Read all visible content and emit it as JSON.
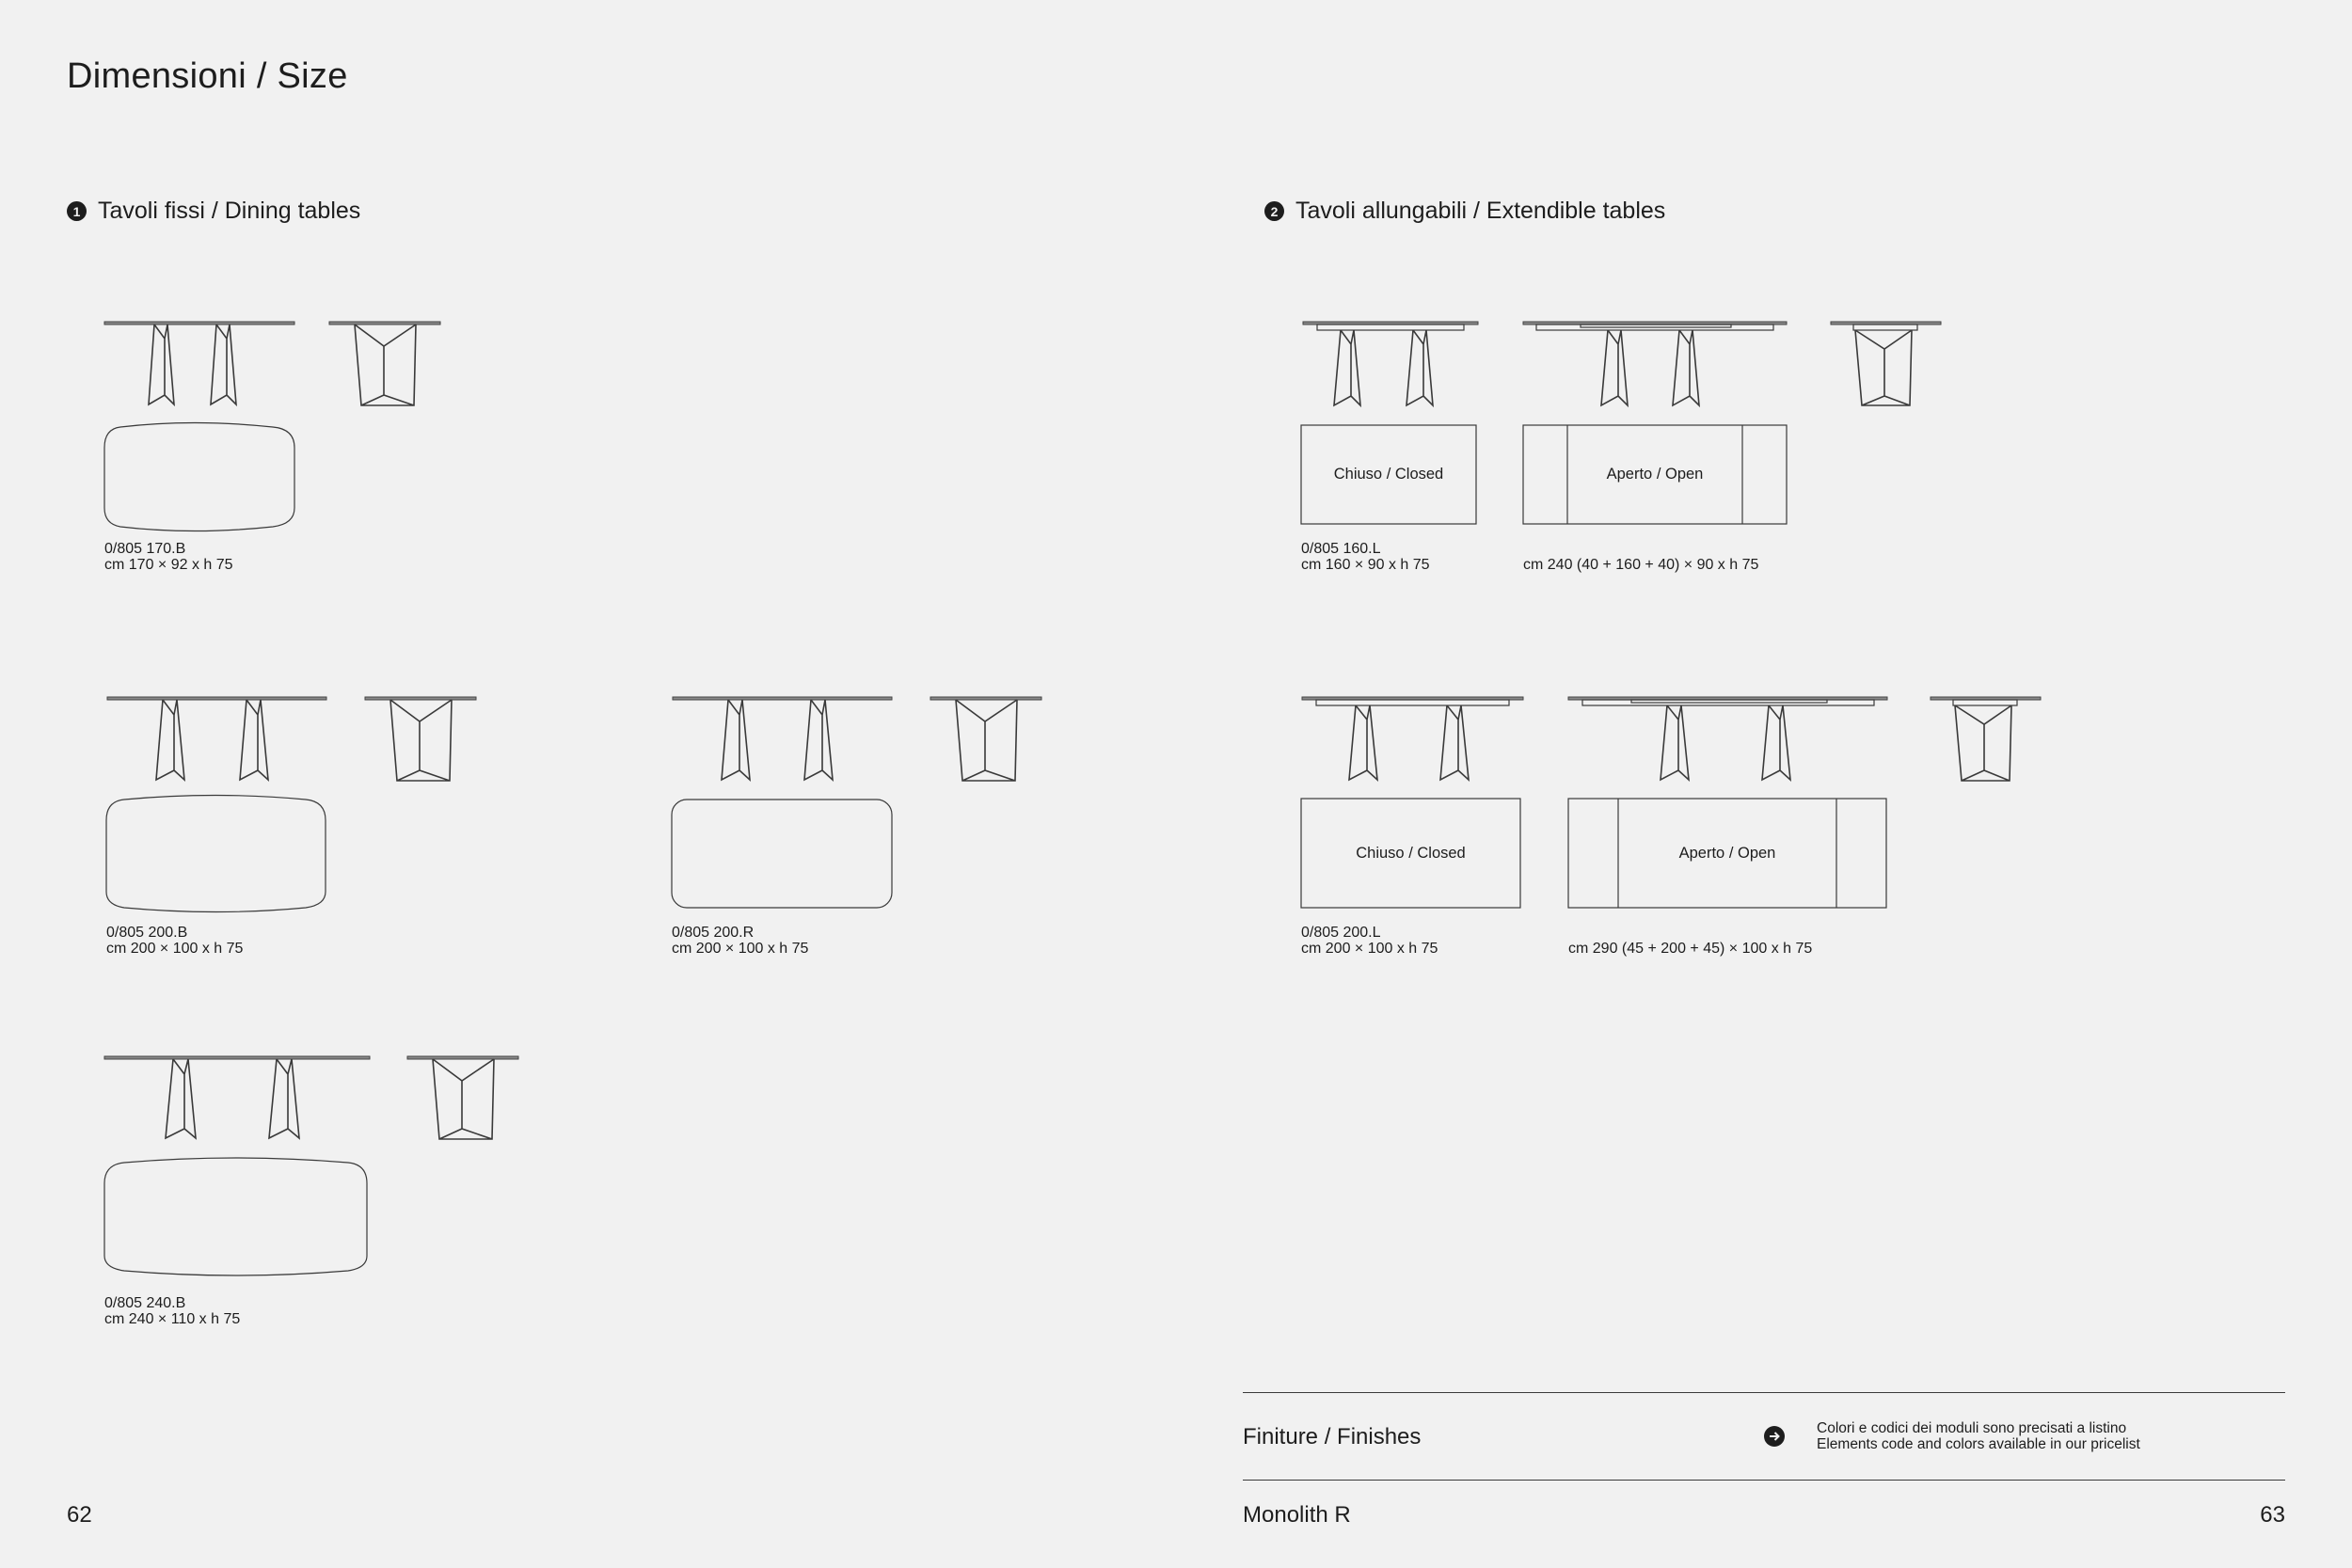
{
  "page_title": "Dimensioni / Size",
  "sections": [
    {
      "number": "1",
      "title": "Tavoli fissi / Dining tables"
    },
    {
      "number": "2",
      "title": "Tavoli allungabili / Extendible tables"
    }
  ],
  "fixed_tables": [
    {
      "code": "0/805 170.B",
      "size": "cm 170 × 92 x h 75"
    },
    {
      "code": "0/805 200.B",
      "size": "cm 200 × 100 x h 75"
    },
    {
      "code": "0/805 200.R",
      "size": "cm 200 × 100 x h 75"
    },
    {
      "code": "0/805 240.B",
      "size": "cm 240 × 110 x h 75"
    }
  ],
  "extendible_tables": [
    {
      "code": "0/805 160.L",
      "size_closed": "cm 160 × 90 x h 75",
      "size_open": "cm 240 (40 + 160 + 40) × 90 x h 75",
      "closed_label": "Chiuso / Closed",
      "open_label": "Aperto / Open"
    },
    {
      "code": "0/805 200.L",
      "size_closed": "cm 200 × 100 x h 75",
      "size_open": "cm 290 (45 + 200 + 45) × 100 x h 75",
      "closed_label": "Chiuso / Closed",
      "open_label": "Aperto / Open"
    }
  ],
  "footer": {
    "finishes_label": "Finiture / Finishes",
    "note_line1": "Colori e codici dei moduli sono precisati a listino",
    "note_line2": "Elements code and colors available in our pricelist",
    "product_name": "Monolith R",
    "page_left": "62",
    "page_right": "63"
  },
  "arrow_icon": "arrow-right-circle-icon"
}
